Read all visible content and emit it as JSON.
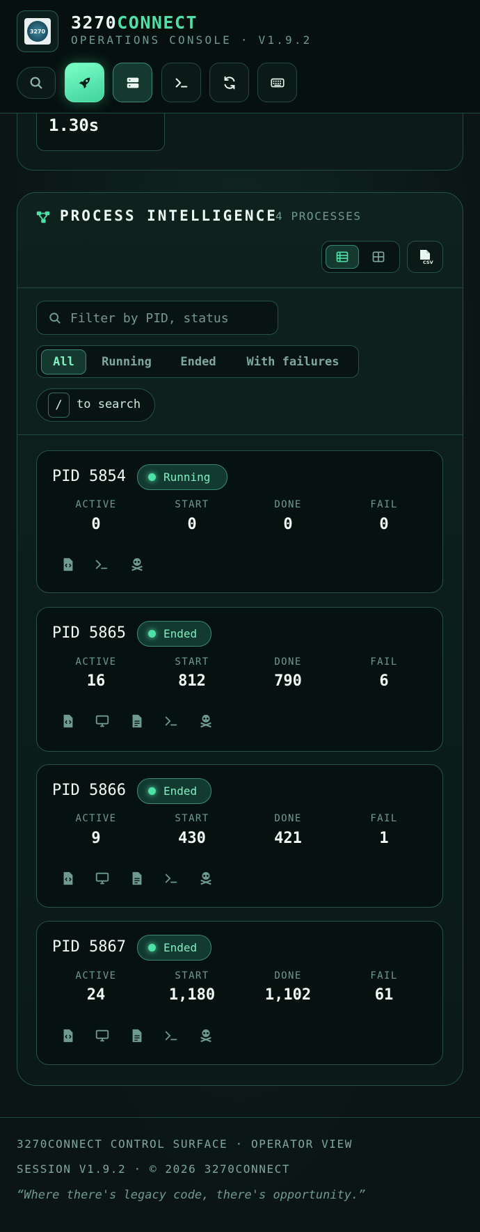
{
  "header": {
    "brand_main": "3270",
    "brand_accent": "CONNECT",
    "subtitle": "OPERATIONS CONSOLE · V1.9.2",
    "logo_text": "3270",
    "toolbar": [
      {
        "name": "search-button",
        "icon": "search-icon"
      },
      {
        "name": "launch-button",
        "icon": "rocket-icon",
        "active": true
      },
      {
        "name": "servers-button",
        "icon": "server-icon"
      },
      {
        "name": "terminal-button",
        "icon": "terminal-icon"
      },
      {
        "name": "refresh-button",
        "icon": "refresh-icon"
      },
      {
        "name": "keyboard-button",
        "icon": "keyboard-icon"
      }
    ]
  },
  "top_metric": {
    "value": "1.30s"
  },
  "process_panel": {
    "title": "PROCESS INTELLIGENCE",
    "count": "4 PROCESSES",
    "filter_placeholder": "Filter by PID, status",
    "segments": [
      "All",
      "Running",
      "Ended",
      "With failures"
    ],
    "selected_segment": "All",
    "hint_key": "/",
    "hint_text": "to search",
    "stat_labels": [
      "ACTIVE",
      "START",
      "DONE",
      "FAIL"
    ],
    "processes": [
      {
        "pid": "PID 5854",
        "status": "Running",
        "active": "0",
        "start": "0",
        "done": "0",
        "fail": "0",
        "actions": [
          "code-file-icon",
          "terminal-icon",
          "skull-icon"
        ]
      },
      {
        "pid": "PID 5865",
        "status": "Ended",
        "active": "16",
        "start": "812",
        "done": "790",
        "fail": "6",
        "actions": [
          "code-file-icon",
          "monitor-icon",
          "document-icon",
          "terminal-icon",
          "skull-icon"
        ]
      },
      {
        "pid": "PID 5866",
        "status": "Ended",
        "active": "9",
        "start": "430",
        "done": "421",
        "fail": "1",
        "actions": [
          "code-file-icon",
          "monitor-icon",
          "document-icon",
          "terminal-icon",
          "skull-icon"
        ]
      },
      {
        "pid": "PID 5867",
        "status": "Ended",
        "active": "24",
        "start": "1,180",
        "done": "1,102",
        "fail": "61",
        "actions": [
          "code-file-icon",
          "monitor-icon",
          "document-icon",
          "terminal-icon",
          "skull-icon"
        ]
      }
    ]
  },
  "footer": {
    "line1": "3270CONNECT CONTROL SURFACE · OPERATOR VIEW",
    "line2": "SESSION V1.9.2 · © 2026 3270CONNECT",
    "quote": "“Where there's legacy code, there's opportunity.”"
  },
  "colors": {
    "accent": "#4fe0a8",
    "background": "#0b1715",
    "card": "#061210",
    "border": "#24524a"
  }
}
